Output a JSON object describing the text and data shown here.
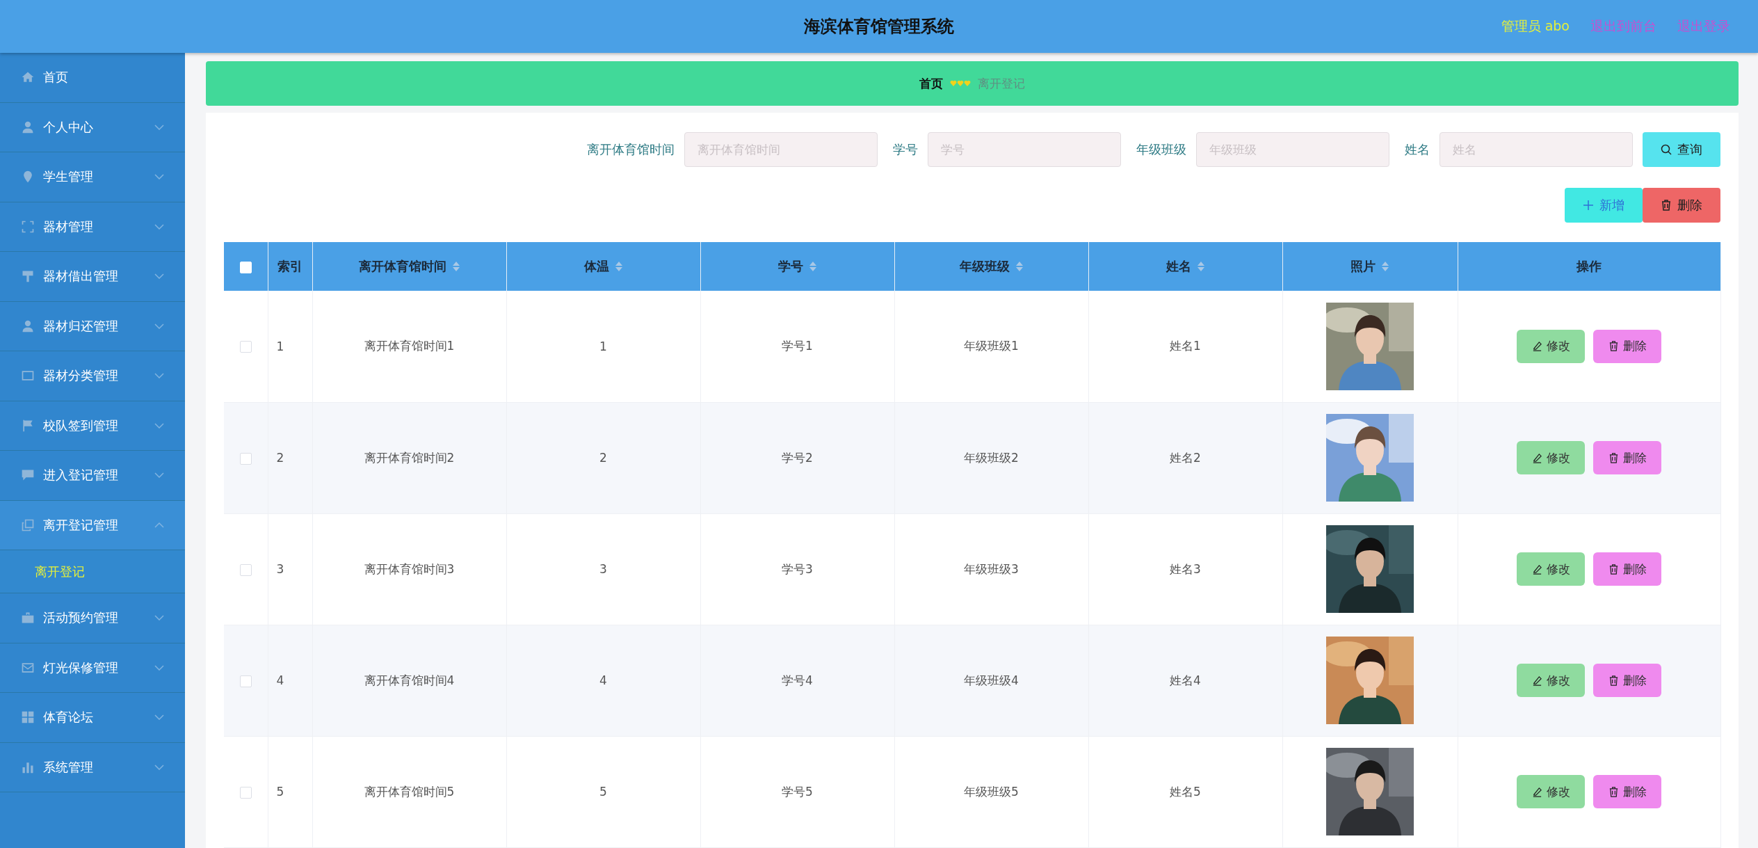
{
  "header": {
    "title": "海滨体育馆管理系统",
    "user": "管理员 abo",
    "links": [
      "退出到前台",
      "退出登录"
    ]
  },
  "sidebar": {
    "items": [
      {
        "label": "首页",
        "expandable": false
      },
      {
        "label": "个人中心",
        "expandable": true,
        "expanded": false
      },
      {
        "label": "学生管理",
        "expandable": true,
        "expanded": false
      },
      {
        "label": "器材管理",
        "expandable": true,
        "expanded": false
      },
      {
        "label": "器材借出管理",
        "expandable": true,
        "expanded": false
      },
      {
        "label": "器材归还管理",
        "expandable": true,
        "expanded": false
      },
      {
        "label": "器材分类管理",
        "expandable": true,
        "expanded": false
      },
      {
        "label": "校队签到管理",
        "expandable": true,
        "expanded": false
      },
      {
        "label": "进入登记管理",
        "expandable": true,
        "expanded": false
      },
      {
        "label": "离开登记管理",
        "expandable": true,
        "expanded": true,
        "children": [
          {
            "label": "离开登记",
            "selected": true
          }
        ]
      },
      {
        "label": "活动预约管理",
        "expandable": true,
        "expanded": false
      },
      {
        "label": "灯光保修管理",
        "expandable": true,
        "expanded": false
      },
      {
        "label": "体育论坛",
        "expandable": true,
        "expanded": false
      },
      {
        "label": "系统管理",
        "expandable": true,
        "expanded": false
      }
    ]
  },
  "breadcrumb": [
    {
      "label": "首页",
      "current": false
    },
    {
      "label": "离开登记",
      "current": true
    }
  ],
  "search": {
    "fields": [
      {
        "label": "离开体育馆时间",
        "placeholder": "离开体育馆时间"
      },
      {
        "label": "学号",
        "placeholder": "学号"
      },
      {
        "label": "年级班级",
        "placeholder": "年级班级"
      },
      {
        "label": "姓名",
        "placeholder": "姓名"
      }
    ],
    "button": "查询"
  },
  "actions": {
    "add": "新增",
    "delete": "删除"
  },
  "table": {
    "all_checked": false,
    "columns": [
      {
        "label": "索引",
        "sortable": false
      },
      {
        "label": "离开体育馆时间",
        "sortable": true
      },
      {
        "label": "体温",
        "sortable": true
      },
      {
        "label": "学号",
        "sortable": true
      },
      {
        "label": "年级班级",
        "sortable": true
      },
      {
        "label": "姓名",
        "sortable": true
      },
      {
        "label": "照片",
        "sortable": true
      },
      {
        "label": "操作",
        "sortable": false
      }
    ],
    "rows": [
      {
        "checked": false,
        "cells": [
          "1",
          "离开体育馆时间1",
          "1",
          "学号1",
          "年级班级1",
          "姓名1"
        ],
        "buttons": [
          "修改",
          "删除"
        ]
      },
      {
        "checked": false,
        "cells": [
          "2",
          "离开体育馆时间2",
          "2",
          "学号2",
          "年级班级2",
          "姓名2"
        ],
        "buttons": [
          "修改",
          "删除"
        ]
      },
      {
        "checked": false,
        "cells": [
          "3",
          "离开体育馆时间3",
          "3",
          "学号3",
          "年级班级3",
          "姓名3"
        ],
        "buttons": [
          "修改",
          "删除"
        ]
      },
      {
        "checked": false,
        "cells": [
          "4",
          "离开体育馆时间4",
          "4",
          "学号4",
          "年级班级4",
          "姓名4"
        ],
        "buttons": [
          "修改",
          "删除"
        ]
      },
      {
        "checked": false,
        "cells": [
          "5",
          "离开体育馆时间5",
          "5",
          "学号5",
          "年级班级5",
          "姓名5"
        ],
        "buttons": [
          "修改",
          "删除"
        ]
      }
    ]
  }
}
